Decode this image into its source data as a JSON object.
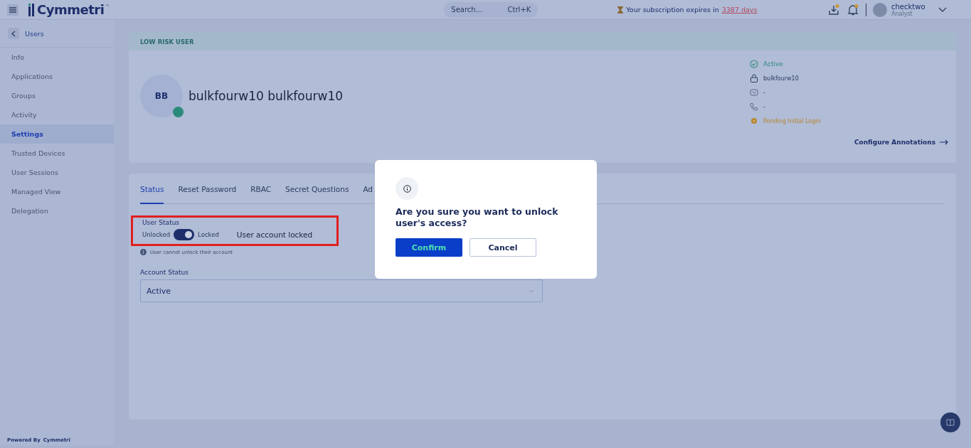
{
  "header": {
    "logo": "Cymmetri",
    "logo_mark": "™",
    "search": {
      "placeholder": "Search...",
      "shortcut": "Ctrl+K"
    },
    "subscription": {
      "text": "Your subscription expires in",
      "link": "3387 days"
    },
    "user": {
      "name": "checktwo",
      "role": "Analyst"
    }
  },
  "sidebar": {
    "back": "Users",
    "items": [
      {
        "label": "Info",
        "selected": false
      },
      {
        "label": "Applications",
        "selected": false
      },
      {
        "label": "Groups",
        "selected": false
      },
      {
        "label": "Activity",
        "selected": false
      },
      {
        "label": "Settings",
        "selected": true
      },
      {
        "label": "Trusted Devices",
        "selected": false
      },
      {
        "label": "User Sessions",
        "selected": false
      },
      {
        "label": "Managed View",
        "selected": false
      },
      {
        "label": "Delegation",
        "selected": false
      }
    ],
    "powered_by": "Powered By",
    "powered_logo": "Cymmetri"
  },
  "profile": {
    "risk": "LOW RISK USER",
    "initials": "BB",
    "online": true,
    "name": "bulkfourw10 bulkfourw10",
    "details": [
      {
        "kind": "status",
        "text": "Active"
      },
      {
        "kind": "username",
        "text": "bulkfourw10"
      },
      {
        "kind": "email",
        "text": "-"
      },
      {
        "kind": "phone",
        "text": "-"
      },
      {
        "kind": "warning",
        "text": "Pending Initial Login"
      }
    ],
    "link": "Configure Annotations"
  },
  "tabs": [
    {
      "label": "Status",
      "selected": true
    },
    {
      "label": "Reset Password",
      "selected": false
    },
    {
      "label": "RBAC",
      "selected": false
    },
    {
      "label": "Secret Questions",
      "selected": false
    },
    {
      "label": "Ad",
      "selected": false
    }
  ],
  "user_status": {
    "label": "User Status",
    "off_label": "Unlocked",
    "on_label": "Locked",
    "locked": true,
    "message": "User account locked",
    "note": "User cannot unlock their account"
  },
  "account_status": {
    "label": "Account Status",
    "value": "Active"
  },
  "dialog": {
    "question": "Are you sure you want to unlock user's access?",
    "buttons": [
      {
        "label": "Confirm",
        "kind": "primary"
      },
      {
        "label": "Cancel",
        "kind": "secondary"
      }
    ]
  }
}
